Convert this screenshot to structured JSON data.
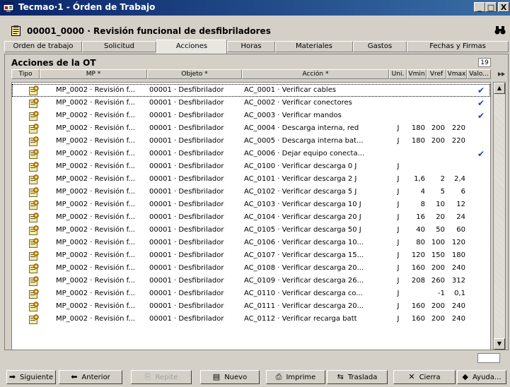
{
  "window": {
    "title": "Tecmao·1 - Órden de Trabajo",
    "controls": {
      "minimize": "_",
      "maximize": "□",
      "close": "X"
    }
  },
  "header": {
    "title": "00001_0000 · Revisión funcional de desfibriladores"
  },
  "tabs": [
    {
      "label": "Orden de trabajo"
    },
    {
      "label": "Solicitud"
    },
    {
      "label": "Acciones",
      "active": true
    },
    {
      "label": "Horas"
    },
    {
      "label": "Materiales"
    },
    {
      "label": "Gastos"
    },
    {
      "label": "Fechas y Firmas"
    }
  ],
  "section": {
    "title": "Acciones de la OT",
    "count": "19"
  },
  "columns": {
    "tipo": "Tipo",
    "mp": "MP *",
    "objeto": "Objeto *",
    "accion": "Acción *",
    "uni": "Uni.",
    "vmin": "Vmin",
    "vref": "Vref",
    "vmax": "Vmax",
    "valo": "Valo..."
  },
  "rows": [
    {
      "mp": "MP_0002 · Revisión f...",
      "objeto": "00001 · Desfibrilador",
      "accion": "AC_0001 · Verificar cables",
      "uni": "",
      "vmin": "",
      "vref": "",
      "vmax": "",
      "valo": "✔"
    },
    {
      "mp": "MP_0002 · Revisión f...",
      "objeto": "00001 · Desfibrilador",
      "accion": "AC_0002 · Verificar conectores",
      "uni": "",
      "vmin": "",
      "vref": "",
      "vmax": "",
      "valo": "✔"
    },
    {
      "mp": "MP_0002 · Revisión f...",
      "objeto": "00001 · Desfibrilador",
      "accion": "AC_0003 · Verificar mandos",
      "uni": "",
      "vmin": "",
      "vref": "",
      "vmax": "",
      "valo": "✔"
    },
    {
      "mp": "MP_0002 · Revisión f...",
      "objeto": "00001 · Desfibrilador",
      "accion": "AC_0004 · Descarga interna, red",
      "uni": "J",
      "vmin": "180",
      "vref": "200",
      "vmax": "220",
      "valo": ""
    },
    {
      "mp": "MP_0002 · Revisión f...",
      "objeto": "00001 · Desfibrilador",
      "accion": "AC_0005 · Descarga interna bat...",
      "uni": "J",
      "vmin": "180",
      "vref": "200",
      "vmax": "220",
      "valo": ""
    },
    {
      "mp": "MP_0002 · Revisión f...",
      "objeto": "00001 · Desfibrilador",
      "accion": "AC_0006 · Dejar equipo conecta...",
      "uni": "",
      "vmin": "",
      "vref": "",
      "vmax": "",
      "valo": "✔"
    },
    {
      "mp": "MP_0002 · Revisión f...",
      "objeto": "00001 · Desfibrilador",
      "accion": "AC_0100 · Verificar descarga 0 J",
      "uni": "J",
      "vmin": "",
      "vref": "",
      "vmax": "",
      "valo": ""
    },
    {
      "mp": "MP_0002 · Revisión f...",
      "objeto": "00001 · Desfibrilador",
      "accion": "AC_0101 · Verificar descarga 2 J",
      "uni": "J",
      "vmin": "1,6",
      "vref": "2",
      "vmax": "2,4",
      "valo": ""
    },
    {
      "mp": "MP_0002 · Revisión f...",
      "objeto": "00001 · Desfibrilador",
      "accion": "AC_0102 · Verificar descarga 5 J",
      "uni": "J",
      "vmin": "4",
      "vref": "5",
      "vmax": "6",
      "valo": ""
    },
    {
      "mp": "MP_0002 · Revisión f...",
      "objeto": "00001 · Desfibrilador",
      "accion": "AC_0103 · Verificar descarga 10 J",
      "uni": "J",
      "vmin": "8",
      "vref": "10",
      "vmax": "12",
      "valo": ""
    },
    {
      "mp": "MP_0002 · Revisión f...",
      "objeto": "00001 · Desfibrilador",
      "accion": "AC_0104 · Verificar descarga 20 J",
      "uni": "J",
      "vmin": "16",
      "vref": "20",
      "vmax": "24",
      "valo": ""
    },
    {
      "mp": "MP_0002 · Revisión f...",
      "objeto": "00001 · Desfibrilador",
      "accion": "AC_0105 · Verificar descarga 50 J",
      "uni": "J",
      "vmin": "40",
      "vref": "50",
      "vmax": "60",
      "valo": ""
    },
    {
      "mp": "MP_0002 · Revisión f...",
      "objeto": "00001 · Desfibrilador",
      "accion": "AC_0106 · Verificar descarga 10...",
      "uni": "J",
      "vmin": "80",
      "vref": "100",
      "vmax": "120",
      "valo": ""
    },
    {
      "mp": "MP_0002 · Revisión f...",
      "objeto": "00001 · Desfibrilador",
      "accion": "AC_0107 · Verificar descarga 15...",
      "uni": "J",
      "vmin": "120",
      "vref": "150",
      "vmax": "180",
      "valo": ""
    },
    {
      "mp": "MP_0002 · Revisión f...",
      "objeto": "00001 · Desfibrilador",
      "accion": "AC_0108 · Verificar descarga 20...",
      "uni": "J",
      "vmin": "160",
      "vref": "200",
      "vmax": "240",
      "valo": ""
    },
    {
      "mp": "MP_0002 · Revisión f...",
      "objeto": "00001 · Desfibrilador",
      "accion": "AC_0109 · Verificar descarga 26...",
      "uni": "J",
      "vmin": "208",
      "vref": "260",
      "vmax": "312",
      "valo": ""
    },
    {
      "mp": "MP_0002 · Revisión f...",
      "objeto": "00001 · Desfibrilador",
      "accion": "AC_0110 · Verificar descarga co...",
      "uni": "J",
      "vmin": "",
      "vref": "-1",
      "vmax": "0,1",
      "valo": ""
    },
    {
      "mp": "MP_0002 · Revisión f...",
      "objeto": "00001 · Desfibrilador",
      "accion": "AC_0111 · Verificar descarga 20...",
      "uni": "J",
      "vmin": "160",
      "vref": "200",
      "vmax": "240",
      "valo": ""
    },
    {
      "mp": "MP_0002 · Revisión f...",
      "objeto": "00001 · Desfibrilador",
      "accion": "AC_0112 · Verificar recarga batt",
      "uni": "J",
      "vmin": "160",
      "vref": "200",
      "vmax": "240",
      "valo": ""
    }
  ],
  "buttons": [
    {
      "name": "siguiente-button",
      "label": "Siguiente",
      "icon": "arrow-right-icon",
      "glyph": "➡"
    },
    {
      "name": "anterior-button",
      "label": "Anterior",
      "icon": "arrow-left-icon",
      "glyph": "⬅"
    },
    {
      "name": "repite-button",
      "label": "Repite",
      "icon": "repeat-icon",
      "glyph": "⎘",
      "disabled": true
    },
    {
      "name": "nuevo-button",
      "label": "Nuevo",
      "icon": "new-document-icon",
      "glyph": "▤"
    },
    {
      "name": "imprime-button",
      "label": "Imprime",
      "icon": "printer-icon",
      "glyph": "⎙"
    },
    {
      "name": "traslada-button",
      "label": "Traslada",
      "icon": "transfer-icon",
      "glyph": "⇆"
    },
    {
      "name": "cierra-button",
      "label": "Cierra",
      "icon": "close-x-icon",
      "glyph": "✕"
    },
    {
      "name": "ayuda-button",
      "label": "Ayuda...",
      "icon": "help-icon",
      "glyph": "◆"
    }
  ],
  "colors": {
    "titlebar_start": "#0a246a",
    "titlebar_end": "#3a6ea5",
    "window_bg": "#d4d0c8",
    "check": "#1a3fd6"
  }
}
